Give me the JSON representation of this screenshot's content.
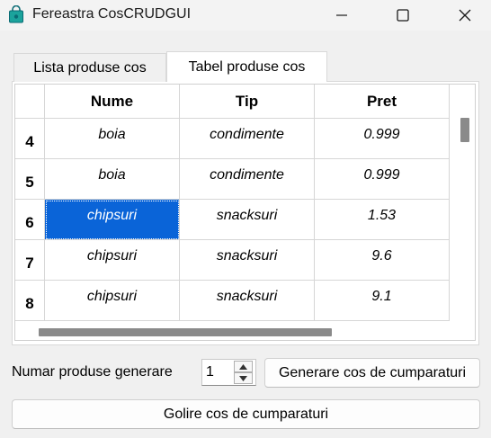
{
  "window": {
    "title": "Fereastra CosCRUDGUI",
    "icon": "shopping-bag-icon",
    "controls": [
      "minimize-icon",
      "maximize-icon",
      "close-icon"
    ]
  },
  "tabs": [
    {
      "label": "Lista produse cos",
      "active": false
    },
    {
      "label": "Tabel produse cos",
      "active": true
    }
  ],
  "table": {
    "columns": [
      "Nume",
      "Tip",
      "Pret"
    ],
    "rows": [
      {
        "index": "4",
        "cells": [
          "boia",
          "condimente",
          "0.999"
        ]
      },
      {
        "index": "5",
        "cells": [
          "boia",
          "condimente",
          "0.999"
        ]
      },
      {
        "index": "6",
        "cells": [
          "chipsuri",
          "snacksuri",
          "1.53"
        ]
      },
      {
        "index": "7",
        "cells": [
          "chipsuri",
          "snacksuri",
          "9.6"
        ]
      },
      {
        "index": "8",
        "cells": [
          "chipsuri",
          "snacksuri",
          "9.1"
        ]
      }
    ],
    "selected": {
      "row": "6",
      "column": "Nume"
    },
    "selection_color": "#0a64d8"
  },
  "controls": {
    "count_label": "Numar produse generare",
    "count_value": "1",
    "generate_button": "Generare cos de cumparaturi",
    "clear_button": "Golire cos de cumparaturi"
  }
}
